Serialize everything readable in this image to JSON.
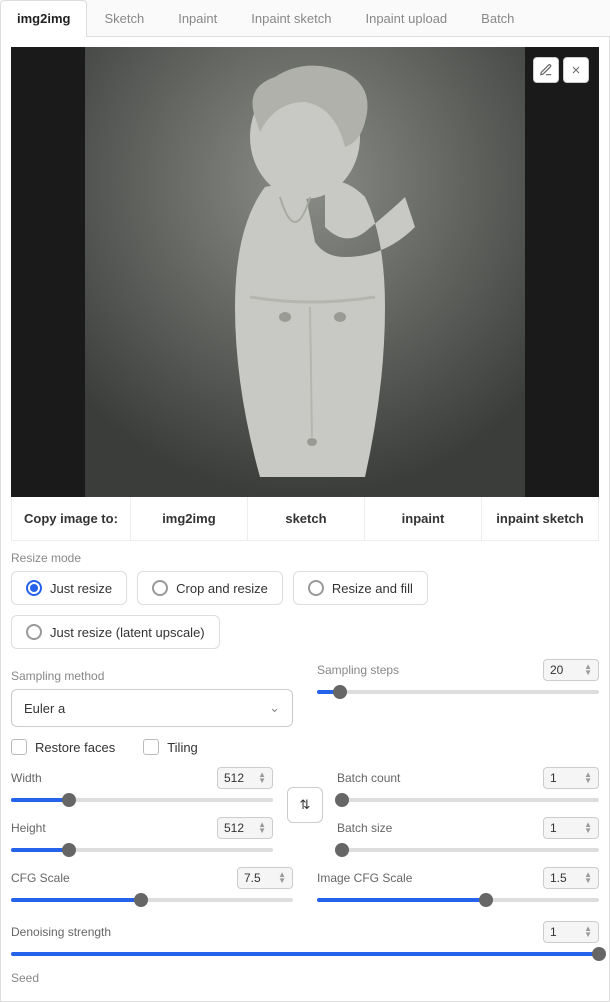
{
  "tabs": [
    "img2img",
    "Sketch",
    "Inpaint",
    "Inpaint sketch",
    "Inpaint upload",
    "Batch"
  ],
  "active_tab": 0,
  "copy": {
    "label": "Copy image to:",
    "targets": [
      "img2img",
      "sketch",
      "inpaint",
      "inpaint sketch"
    ]
  },
  "resize": {
    "label": "Resize mode",
    "options": [
      "Just resize",
      "Crop and resize",
      "Resize and fill",
      "Just resize (latent upscale)"
    ],
    "selected": 0
  },
  "sampling": {
    "method_label": "Sampling method",
    "method_value": "Euler a",
    "steps_label": "Sampling steps",
    "steps_value": "20",
    "steps_pct": 8
  },
  "checks": {
    "restore_faces": "Restore faces",
    "tiling": "Tiling"
  },
  "width": {
    "label": "Width",
    "value": "512",
    "pct": 22
  },
  "height": {
    "label": "Height",
    "value": "512",
    "pct": 22
  },
  "batch_count": {
    "label": "Batch count",
    "value": "1",
    "pct": 2
  },
  "batch_size": {
    "label": "Batch size",
    "value": "1",
    "pct": 2
  },
  "cfg": {
    "label": "CFG Scale",
    "value": "7.5",
    "pct": 46
  },
  "image_cfg": {
    "label": "Image CFG Scale",
    "value": "1.5",
    "pct": 60
  },
  "denoise": {
    "label": "Denoising strength",
    "value": "1",
    "pct": 100
  },
  "seed": {
    "label": "Seed"
  }
}
